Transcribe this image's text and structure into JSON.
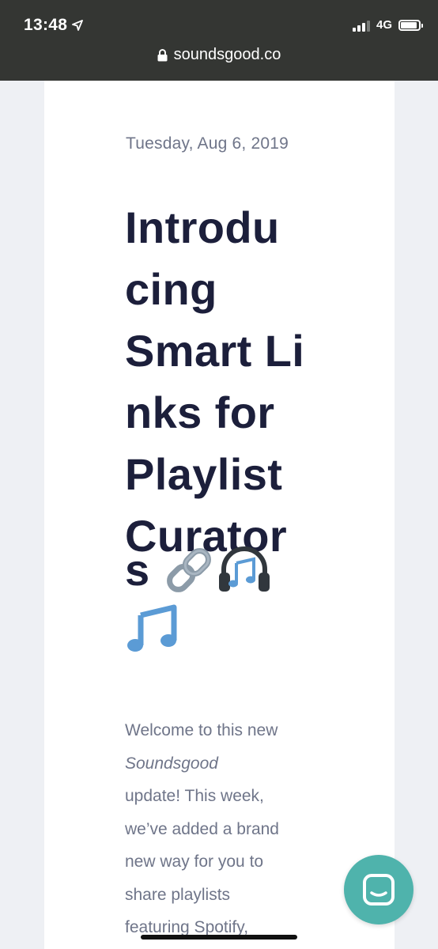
{
  "status_bar": {
    "time": "13:48",
    "network": "4G",
    "signal_bars_active": 3,
    "signal_bars_total": 4,
    "icons": [
      "location-arrow-icon",
      "signal-icon",
      "battery-icon"
    ]
  },
  "browser": {
    "url": "soundsgood.co",
    "icons": [
      "lock-icon"
    ]
  },
  "post": {
    "date": "Tuesday, Aug 6, 2019",
    "title_lines": [
      "Introdu",
      "cing",
      "Smart Li",
      "nks for",
      "Playlist",
      "Curator",
      "s"
    ],
    "title_emojis": [
      "link-icon",
      "headphones-icon",
      "musical-notes-icon"
    ],
    "body_lines": [
      "Welcome to this new",
      "Soundsgood",
      "update! This week,",
      "we’ve added a brand",
      "new way for you to",
      "share playlists",
      "featuring Spotify,"
    ]
  },
  "widgets": {
    "chat_button_icon": "chat-bubble-icon"
  },
  "colors": {
    "status_bar_bg": "#343633",
    "page_bg": "#eef0f4",
    "card_bg": "#ffffff",
    "title_text": "#1c1f3b",
    "muted_text": "#6f7589",
    "chat_button": "#4fb3ac",
    "emoji_blue": "#5b9bd5",
    "link_gray": "#8c9ba8"
  }
}
